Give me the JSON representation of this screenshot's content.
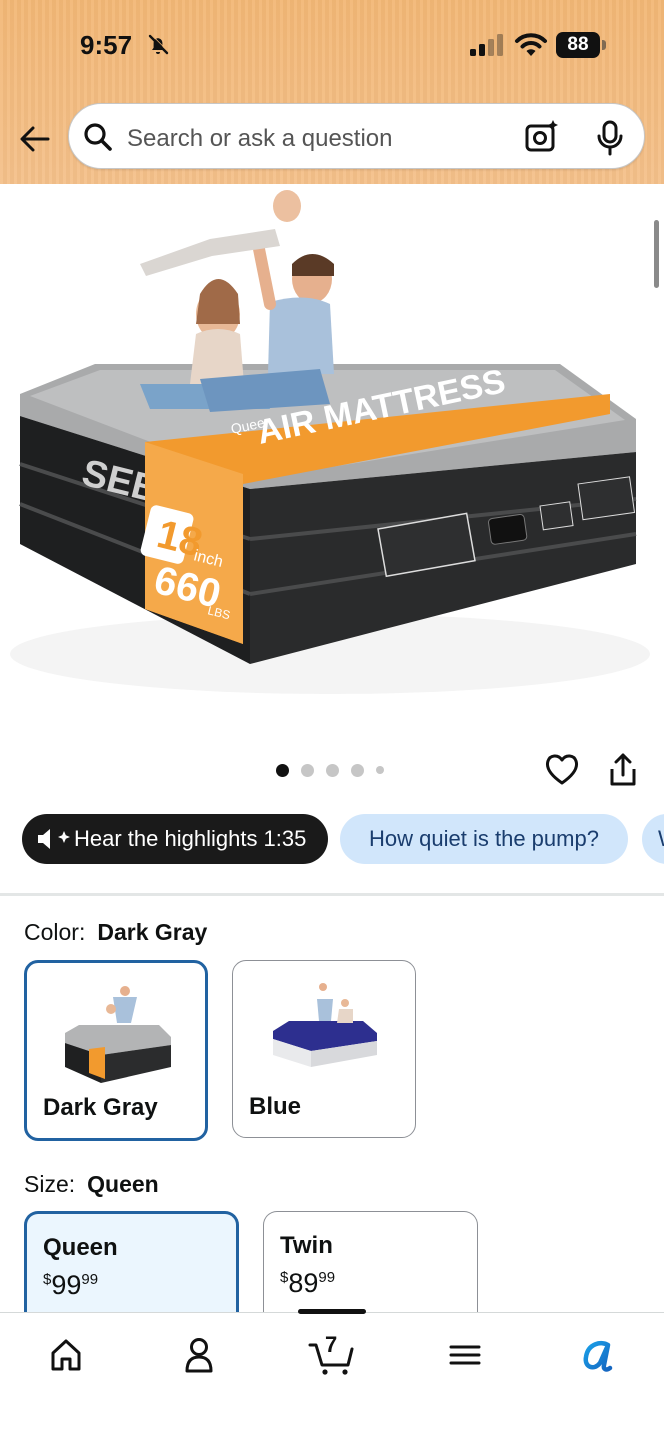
{
  "status_bar": {
    "time": "9:57",
    "battery": "88"
  },
  "search": {
    "placeholder": "Search or ask a question"
  },
  "product_image": {
    "brand_text": "SEBOR",
    "band_size": "Queen",
    "band_title": "AIR MATTRESS",
    "height_value": "18",
    "height_unit": "inch",
    "weight_value": "660",
    "weight_unit": "LBS"
  },
  "carousel": {
    "count": 5,
    "active_index": 0
  },
  "chips": {
    "hear_label": "Hear the highlights 1:35",
    "question_label": "How quiet is the pump?",
    "next_label": "W"
  },
  "color_option": {
    "label": "Color:",
    "selected": "Dark Gray",
    "swatches": [
      {
        "label": "Dark Gray",
        "selected": true
      },
      {
        "label": "Blue",
        "selected": false
      }
    ]
  },
  "size_option": {
    "label": "Size:",
    "selected": "Queen",
    "cards": [
      {
        "name": "Queen",
        "currency": "$",
        "whole": "99",
        "fraction": "99",
        "selected": true
      },
      {
        "name": "Twin",
        "currency": "$",
        "whole": "89",
        "fraction": "99",
        "selected": false
      }
    ]
  },
  "bottom_nav": {
    "cart_count": "7"
  },
  "colors": {
    "header": "#f2b775",
    "selected_border": "#2162a1",
    "chip_blue": "#d1e6fb",
    "band_orange": "#f29a2e"
  }
}
